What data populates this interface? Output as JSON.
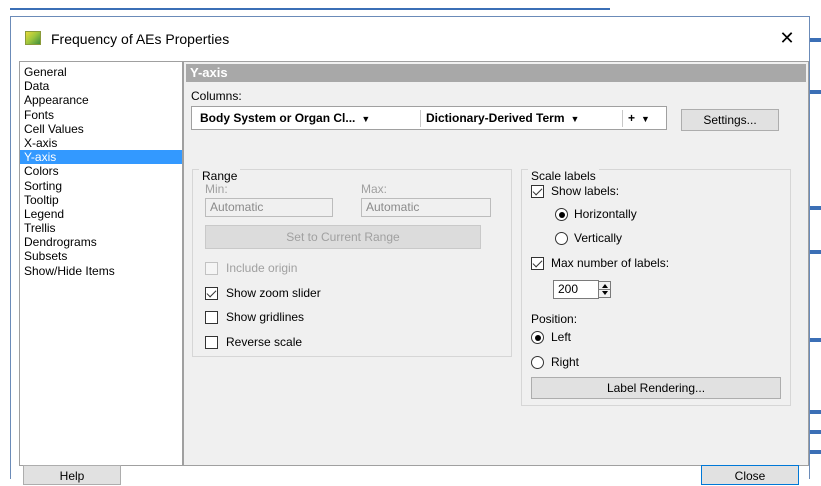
{
  "window": {
    "title": "Frequency of AEs  Properties",
    "close_glyph": "✕"
  },
  "nav": {
    "items": [
      {
        "label": "General",
        "active": false
      },
      {
        "label": "Data",
        "active": false
      },
      {
        "label": "Appearance",
        "active": false
      },
      {
        "label": "Fonts",
        "active": false
      },
      {
        "label": "Cell Values",
        "active": false
      },
      {
        "label": "X-axis",
        "active": false
      },
      {
        "label": "Y-axis",
        "active": true
      },
      {
        "label": "Colors",
        "active": false
      },
      {
        "label": "Sorting",
        "active": false
      },
      {
        "label": "Tooltip",
        "active": false
      },
      {
        "label": "Legend",
        "active": false
      },
      {
        "label": "Trellis",
        "active": false
      },
      {
        "label": "Dendrograms",
        "active": false
      },
      {
        "label": "Subsets",
        "active": false
      },
      {
        "label": "Show/Hide Items",
        "active": false
      }
    ]
  },
  "panel": {
    "header": "Y-axis",
    "columns_label": "Columns:",
    "columns": [
      {
        "label": "Body System or Organ Cl...",
        "arrow": "▼"
      },
      {
        "label": "Dictionary-Derived Term",
        "arrow": "▼"
      },
      {
        "label": "+",
        "arrow": "▼"
      }
    ],
    "settings_button": "Settings..."
  },
  "range": {
    "title": "Range",
    "min_label": "Min:",
    "min_value": "Automatic",
    "max_label": "Max:",
    "max_value": "Automatic",
    "set_current_button": "Set to Current Range",
    "include_origin": {
      "label": "Include origin",
      "checked": false,
      "enabled": false
    },
    "show_zoom_slider": {
      "label": "Show zoom slider",
      "checked": true
    },
    "show_gridlines": {
      "label": "Show gridlines",
      "checked": false
    },
    "reverse_scale": {
      "label": "Reverse scale",
      "checked": false
    }
  },
  "scale_labels": {
    "title": "Scale labels",
    "show_labels": {
      "label": "Show labels:",
      "checked": true
    },
    "horizontally": {
      "label": "Horizontally",
      "selected": true
    },
    "vertically": {
      "label": "Vertically",
      "selected": false
    },
    "max_labels": {
      "label": "Max number of labels:",
      "checked": true
    },
    "max_labels_value": "200",
    "position_label": "Position:",
    "left": {
      "label": "Left",
      "selected": true
    },
    "right": {
      "label": "Right",
      "selected": false
    },
    "label_rendering_button": "Label Rendering..."
  },
  "footer": {
    "help_button": "Help",
    "close_button": "Close"
  },
  "colors": {
    "selection": "#3399ff",
    "header_bar": "#a8a8a8",
    "accent_blue": "#3b6fb6"
  }
}
